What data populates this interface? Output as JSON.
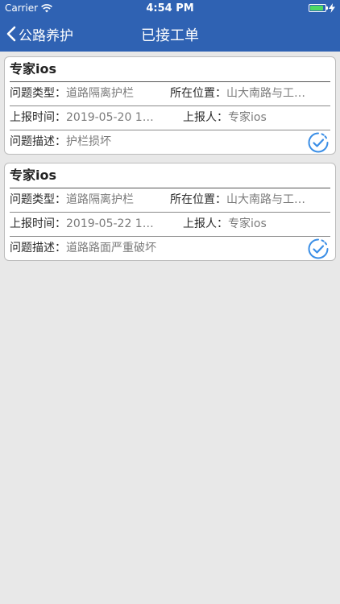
{
  "status_bar": {
    "carrier": "Carrier",
    "time": "4:54 PM"
  },
  "nav": {
    "back_label": "公路养护",
    "title": "已接工单"
  },
  "labels": {
    "type": "问题类型：",
    "location": "所在位置：",
    "time": "上报时间：",
    "reporter": "上报人：",
    "desc": "问题描述："
  },
  "orders": [
    {
      "title": "专家ios",
      "type": "道路隔离护栏",
      "location": "山大南路与工…",
      "time": "2019-05-20 1…",
      "reporter": "专家ios",
      "desc": "护栏损坏"
    },
    {
      "title": "专家ios",
      "type": "道路隔离护栏",
      "location": "山大南路与工…",
      "time": "2019-05-22 1…",
      "reporter": "专家ios",
      "desc": "道路路面严重破坏"
    }
  ],
  "colors": {
    "nav_bg": "#2f62b3",
    "check": "#3a8ee6"
  }
}
